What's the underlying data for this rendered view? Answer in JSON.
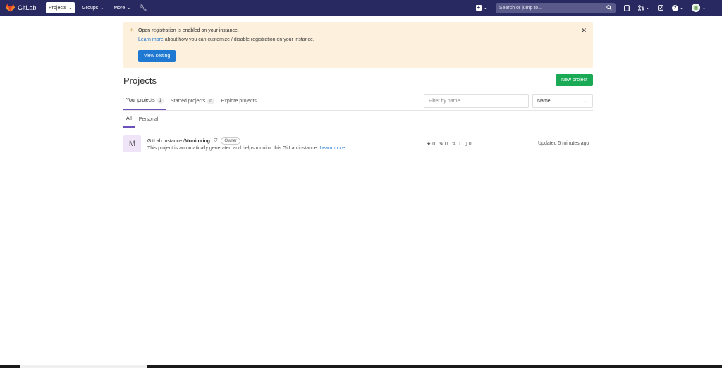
{
  "navbar": {
    "brand": "GitLab",
    "projects_label": "Projects",
    "groups_label": "Groups",
    "more_label": "More",
    "search_placeholder": "Search or jump to..."
  },
  "alert": {
    "title": "Open registration is enabled on your instance.",
    "link": "Learn more",
    "body": " about how you can customize / disable registration on your instance.",
    "button": "View setting"
  },
  "header": {
    "title": "Projects",
    "new_project": "New project"
  },
  "tabs": [
    {
      "label": "Your projects",
      "count": "1"
    },
    {
      "label": "Starred projects",
      "count": "0"
    },
    {
      "label": "Explore projects"
    }
  ],
  "filter": {
    "placeholder": "Filter by name..."
  },
  "sort": {
    "value": "Name"
  },
  "subtabs": [
    "All",
    "Personal"
  ],
  "project": {
    "avatar_letter": "M",
    "namespace": "GitLab Instance / ",
    "name": "Monitoring",
    "role": "Owner",
    "description": "This project is automatically generated and helps monitor this GitLab instance. ",
    "description_link": "Learn more.",
    "stars": "0",
    "forks": "0",
    "merge_requests": "0",
    "issues": "0",
    "updated": "Updated 5 minutes ago"
  },
  "colors": {
    "navbar": "#292961",
    "primary": "#1f78d1",
    "success": "#1aaa55",
    "alert_bg": "#fdf0dd",
    "tab_active": "#6b4fbb"
  },
  "icons": [
    "gitlab-logo-icon",
    "wrench-icon",
    "plus-icon",
    "search-icon",
    "issues-icon",
    "merge-request-icon",
    "todo-icon",
    "help-icon",
    "avatar-icon",
    "warning-icon",
    "close-icon",
    "shield-icon",
    "star-icon",
    "fork-icon"
  ]
}
